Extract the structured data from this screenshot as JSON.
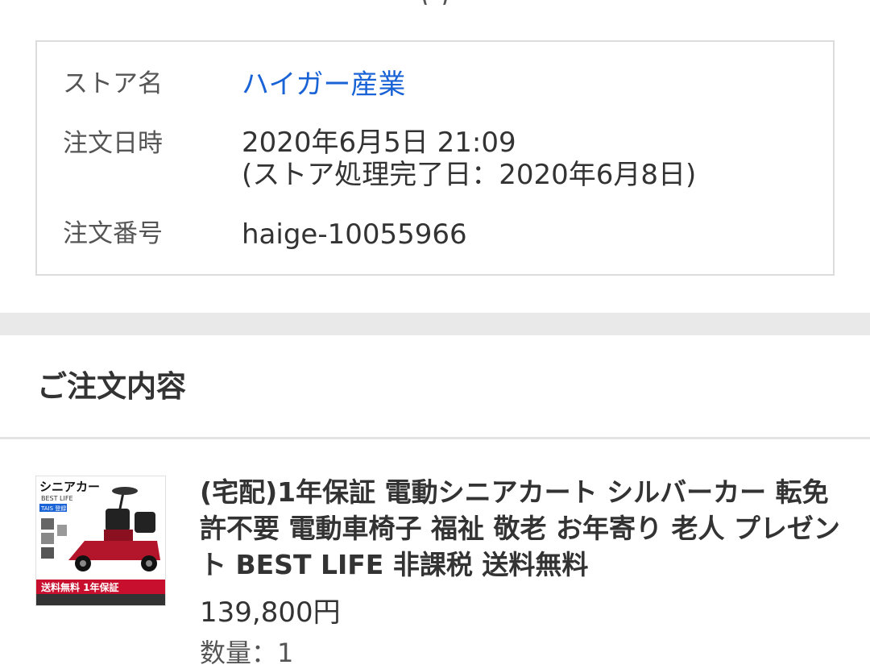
{
  "header_partial": "(       )",
  "order_info": {
    "store_label": "ストア名",
    "store_name": "ハイガー産業",
    "date_label": "注文日時",
    "date_value": "2020年6月5日 21:09",
    "processed_value": "(ストア処理完了日：2020年6月8日)",
    "number_label": "注文番号",
    "number_value": "haige-10055966"
  },
  "order_section": {
    "title": "ご注文内容"
  },
  "item": {
    "title": "(宅配)1年保証 電動シニアカート シルバーカー 転免許不要 電動車椅子 福祉 敬老 お年寄り 老人 プレゼント BEST LIFE 非課税 送料無料",
    "price": "139,800円",
    "quantity_partial": "数量：1",
    "thumbnail": {
      "heading": "シニアカー",
      "sub": "BEST LIFE",
      "badge": "TAIS 登録",
      "banner": "送料無料 1年保証",
      "colors": {
        "body": "#b3162a",
        "seat": "#222222",
        "banner": "#c8102e"
      }
    }
  },
  "colors": {
    "link": "#1a63d6",
    "band": "#e9e9e9",
    "border": "#dcdcdc"
  }
}
